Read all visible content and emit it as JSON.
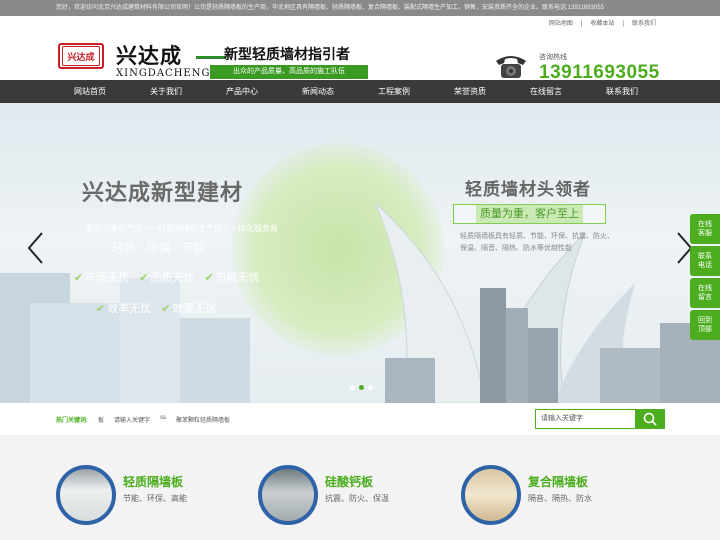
{
  "topbar": {
    "text": "您好，欢迎访问北京兴达成建筑材料有限公司官网！公司是轻质隔墙板的生产商，华北地区具有隔墙板、轻质隔墙板、复合隔墙板、装配式隔墙生产加工，销售，安装资质齐全的企业。联系电话:13911693055"
  },
  "toplinks": [
    "网站地图",
    "|",
    "收藏本站",
    "|",
    "联系我们"
  ],
  "logo": {
    "mark": "兴达成",
    "cn": "兴达成",
    "en": "XINGDACHENG"
  },
  "slogan": {
    "main": "新型轻质墙材指引者",
    "sub": "出众的产品质量、高品质的施工队伍"
  },
  "hotline": {
    "label": "咨询热线",
    "number": "13911693055"
  },
  "nav": [
    "网站首页",
    "关于我们",
    "产品中心",
    "新闻动态",
    "工程案例",
    "荣誉资质",
    "在线留言",
    "联系我们"
  ],
  "banner": {
    "title": "兴达成新型建材",
    "sub": "装配式建筑产品——轻质隔墙板生产施工一体化服务商",
    "mid": "轻质 · 环保 · 节能",
    "line1": [
      "牢固无忧",
      "品质无忧",
      "节能无忧"
    ],
    "line2": [
      "效率无忧",
      "效果无忧"
    ],
    "right_title": "轻质墙材头领者",
    "right_box": "质量为重，客户至上",
    "right_desc": "轻质隔墙板具有轻质、节能、环保、抗震、防火、保温、隔音、隔热、防水等优越性能"
  },
  "side": [
    {
      "l1": "在线",
      "l2": "客服"
    },
    {
      "l1": "联系",
      "l2": "电话"
    },
    {
      "l1": "在线",
      "l2": "留言"
    },
    {
      "l1": "回到",
      "l2": "顶部"
    }
  ],
  "search": {
    "hot_label": "热门关键词:",
    "keywords": [
      "板",
      "请输入关键字",
      "ss",
      "聚苯颗粒轻质隔墙板"
    ],
    "placeholder": "请输入关键字"
  },
  "products": [
    {
      "name": "轻质隔墙板",
      "desc": "节能、环保、高能"
    },
    {
      "name": "硅酸钙板",
      "desc": "抗震、防火、保温"
    },
    {
      "name": "复合隔墙板",
      "desc": "隔音、隔热、防水"
    }
  ],
  "colors": {
    "accent": "#4cae1f",
    "nav": "#3a3a3a",
    "logo_red": "#c81f24",
    "ring": "#2e63a8"
  }
}
